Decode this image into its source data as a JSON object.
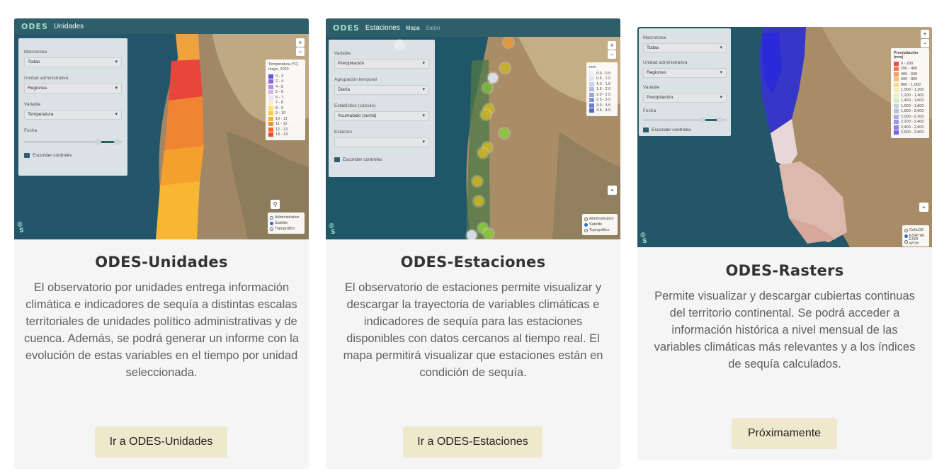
{
  "cards": [
    {
      "title": "ODES-Unidades",
      "description": "El observatorio por unidades entrega información climática e indicadores de sequía a distintas escalas territoriales de unidades político administrativas y de cuenca. Además, se podrá generar un informe con la evolución de estas variables en el tiempo por unidad seleccionada.",
      "button": "Ir a ODES-Unidades",
      "screenshot": {
        "logo": "ODES",
        "app_title": "Unidades",
        "controls": [
          {
            "label": "Macrozona",
            "value": "Todas"
          },
          {
            "label": "Unidad administrativa",
            "value": "Regiones"
          },
          {
            "label": "Variable",
            "value": "Temperatura"
          }
        ],
        "date_label": "Fecha",
        "hide_controls": "Esconder controles",
        "legend_title": "Temperatura (°C) mayo, 2023",
        "legend_items": [
          "0 - 3",
          "2 - 4",
          "4 - 5",
          "5 - 6",
          "6 - 7",
          "7 - 8",
          "8 - 9",
          "9 - 10",
          "10 - 11",
          "11 - 12",
          "12 - 13",
          "13 - 14"
        ],
        "legend_colors": [
          "#5b5bd6",
          "#8a6bd8",
          "#b38fe0",
          "#d2b6e8",
          "#ece3f1",
          "#f5f0c8",
          "#f7e36a",
          "#f7cd4a",
          "#f5b23c",
          "#f39234",
          "#ef6d2e",
          "#e84a2c"
        ],
        "layers": [
          "Administrativo",
          "Satélite",
          "Topográfico"
        ],
        "layer_selected": 1
      }
    },
    {
      "title": "ODES-Estaciones",
      "description": "El observatorio de estaciones permite visualizar y descargar la trayectoria de variables climáticas e indicadores de sequía para las estaciones disponibles con datos cercanos al tiempo real. El mapa permitirá visualizar que estaciones están en condición de sequía.",
      "button": "Ir a ODES-Estaciones",
      "screenshot": {
        "logo": "ODES",
        "app_title": "Estaciones",
        "tabs": [
          "Mapa",
          "Salón"
        ],
        "controls": [
          {
            "label": "Variable",
            "value": "Precipitación"
          },
          {
            "label": "Agrupación temporal",
            "value": "Diaria"
          },
          {
            "label": "Estadístico (cálculo)",
            "value": "Acumulado (suma)"
          },
          {
            "label": "Estación",
            "value": ""
          }
        ],
        "hide_controls": "Esconder controles",
        "legend_title": "mm",
        "legend_items": [
          "0.0 - 0.5",
          "0.5 - 1.0",
          "1.0 - 1.5",
          "1.5 - 2.0",
          "2.0 - 2.5",
          "2.5 - 3.0",
          "3.0 - 3.5",
          "3.5 - 4.0"
        ],
        "legend_colors": [
          "#eef0f8",
          "#dfe3f3",
          "#c9d0ec",
          "#b2bce4",
          "#9aa8dc",
          "#8393d3",
          "#6c7fcb",
          "#5669c1"
        ],
        "layers": [
          "Administrativo",
          "Satélite",
          "Topográfico"
        ],
        "layer_selected": 1
      }
    },
    {
      "title": "ODES-Rasters",
      "description": "Permite visualizar y descargar cubiertas continuas del territorio continental. Se podrá acceder a información histórica a nivel mensual de las variables climáticas más relevantes y a los índices de sequía calculados.",
      "button": "Próximamente",
      "screenshot": {
        "controls": [
          {
            "label": "Macrozona",
            "value": "Todas"
          },
          {
            "label": "Unidad administrativa",
            "value": "Regiones"
          },
          {
            "label": "Variable",
            "value": "Precipitación"
          }
        ],
        "date_label": "Fecha",
        "hide_controls": "Esconder controles",
        "legend_title": "Precipitación (mm)",
        "legend_items": [
          "0 - 200",
          "200 - 400",
          "400 - 600",
          "600 - 800",
          "800 - 1,000",
          "1,000 - 1,200",
          "1,200 - 1,400",
          "1,400 - 1,600",
          "1,600 - 1,800",
          "1,800 - 2,000",
          "2,000 - 2,200",
          "2,200 - 2,400",
          "2,400 - 2,600",
          "2,600 - 2,800"
        ],
        "legend_colors": [
          "#e2524a",
          "#ec7a55",
          "#f29e64",
          "#f6c078",
          "#f8db92",
          "#f6ecae",
          "#ecefc0",
          "#d8e6c8",
          "#c3d6d6",
          "#b4c3e0",
          "#a8aee6",
          "#9b98e8",
          "#8b80e6",
          "#7466e0"
        ],
        "layers": [
          "CeficO8",
          "ESRI WI",
          "ESRI WTM"
        ],
        "layer_selected": 1
      }
    }
  ]
}
